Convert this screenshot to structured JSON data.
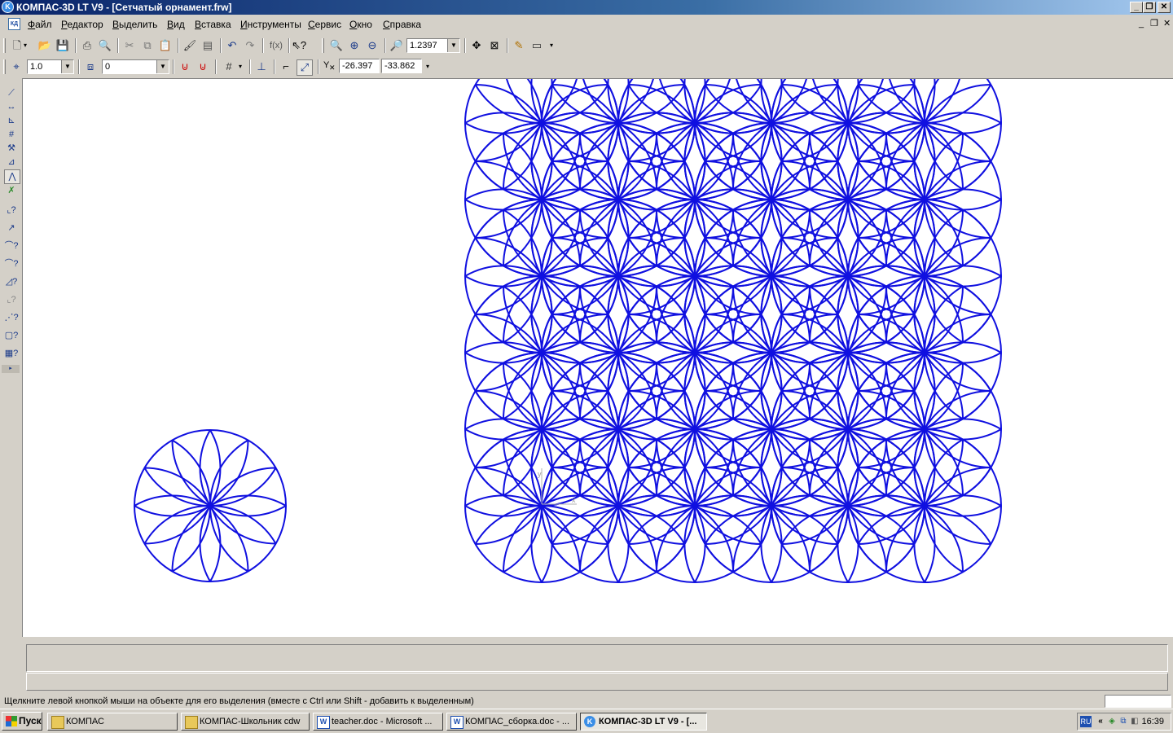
{
  "window": {
    "title": "КОМПАС-3D LT V9 - [Сетчатый орнамент.frw]",
    "controls": [
      "_",
      "❐",
      "✕"
    ]
  },
  "menu": {
    "items": [
      "Файл",
      "Редактор",
      "Выделить",
      "Вид",
      "Вставка",
      "Инструменты",
      "Сервис",
      "Окно",
      "Справка"
    ],
    "mdi_controls": [
      "_",
      "❐",
      "✕"
    ]
  },
  "toolbar_standard": {
    "zoom_value": "1.2397"
  },
  "toolbar_current_state": {
    "step_value": "1.0",
    "layer_value": "0",
    "coord_x": "-26.397",
    "coord_y": "-33.862",
    "coord_prefix": "Y"
  },
  "status": {
    "hint": "Щелкните левой кнопкой мыши на объекте для его выделения (вместе с Ctrl или Shift - добавить к выделенным)"
  },
  "taskbar": {
    "start_label": "Пуск",
    "tasks": [
      {
        "label": "КОМПАС",
        "icon": "folder-icon"
      },
      {
        "label": "КОМПАС-Школьник cdw",
        "icon": "folder-icon"
      },
      {
        "label": "teacher.doc - Microsoft ...",
        "icon": "word-icon"
      },
      {
        "label": "КОМПАС_сборка.doc - ...",
        "icon": "word-icon"
      },
      {
        "label": "КОМПАС-3D LT V9 - [...",
        "icon": "kompas-icon"
      }
    ],
    "tray_lang": "RU",
    "tray_chevron": "«",
    "clock": "16:39"
  },
  "drawing": {
    "stroke_color": "#1010e0",
    "single_rosette": {
      "center_mm": [
        0,
        0
      ],
      "radius": 1,
      "petals": 12
    },
    "ornament_grid": {
      "cols": 6,
      "rows": 6
    }
  }
}
